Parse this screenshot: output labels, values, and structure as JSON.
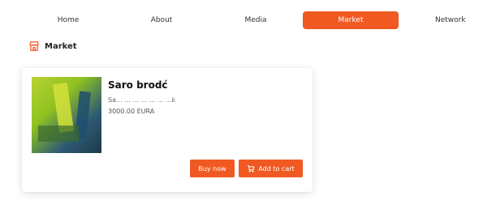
{
  "nav": {
    "items": [
      {
        "label": "Home"
      },
      {
        "label": "About"
      },
      {
        "label": "Media"
      },
      {
        "label": "Market"
      },
      {
        "label": "Network"
      }
    ],
    "active_index": 3
  },
  "section": {
    "title": "Market",
    "icon": "storefront-icon"
  },
  "product": {
    "name": "Saro brodć",
    "description": "Sa... ... ... ... ... ... ...k",
    "price": "3000.00 EURA"
  },
  "actions": {
    "buy_label": "Buy now",
    "cart_label": "Add to cart",
    "cart_icon": "cart-icon"
  },
  "colors": {
    "accent": "#f05a22"
  }
}
